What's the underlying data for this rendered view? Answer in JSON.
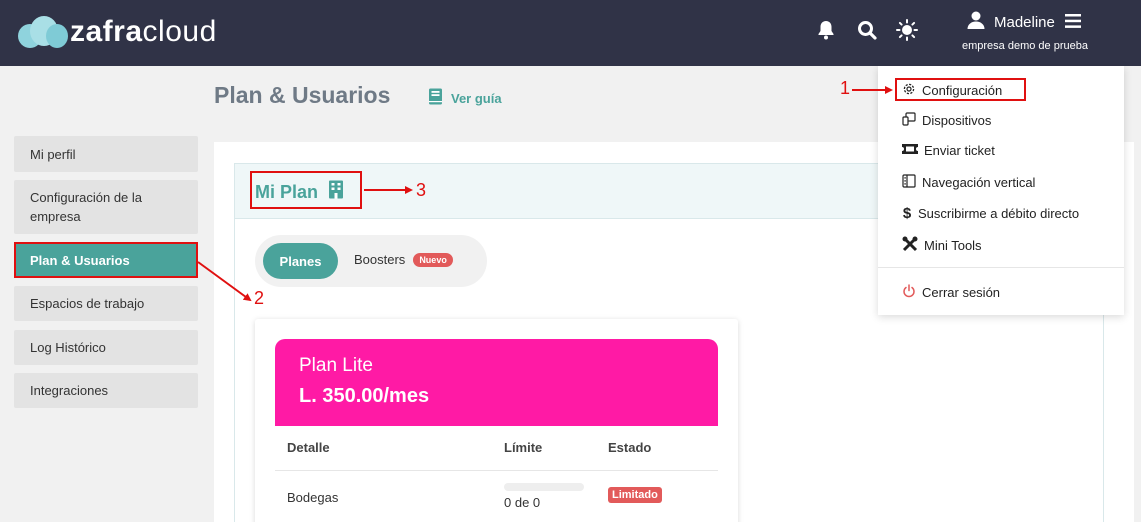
{
  "header": {
    "logo_bold": "zafra",
    "logo_light": "cloud",
    "icons": [
      "bell-icon",
      "search-icon",
      "sun-icon"
    ],
    "user_name": "Madeline",
    "company": "empresa demo de prueba"
  },
  "page": {
    "title": "Plan & Usuarios",
    "guide_link": "Ver guía"
  },
  "sidebar": {
    "items": [
      {
        "label": "Mi perfil"
      },
      {
        "label": "Configuración de la empresa"
      },
      {
        "label": "Plan & Usuarios",
        "active": true
      },
      {
        "label": "Espacios de trabajo"
      },
      {
        "label": "Log Histórico"
      },
      {
        "label": "Integraciones"
      }
    ]
  },
  "plan_section": {
    "title": "Mi Plan",
    "tabs": [
      {
        "label": "Planes",
        "active": true
      },
      {
        "label": "Boosters",
        "badge": "Nuevo"
      }
    ],
    "card": {
      "name": "Plan Lite",
      "price": "L. 350.00/mes",
      "color": "#ff1aa5",
      "columns": [
        "Detalle",
        "Límite",
        "Estado"
      ],
      "rows": [
        {
          "detalle": "Bodegas",
          "limite": "0 de 0",
          "progress": 0,
          "estado": "Limitado"
        }
      ]
    }
  },
  "dropdown": {
    "items": [
      {
        "label": "Configuración",
        "icon": "gear-icon"
      },
      {
        "label": "Dispositivos",
        "icon": "devices-icon"
      },
      {
        "label": "Enviar ticket",
        "icon": "ticket-icon"
      },
      {
        "label": "Navegación vertical",
        "icon": "sidebar-layout-icon"
      },
      {
        "label": "Suscribirme a débito directo",
        "icon": "dollar-icon"
      },
      {
        "label": "Mini Tools",
        "icon": "tools-icon"
      }
    ],
    "logout": {
      "label": "Cerrar sesión",
      "icon": "power-icon"
    }
  },
  "annotations": {
    "marker_1": "1",
    "marker_2": "2",
    "marker_3": "3",
    "color": "#e01010"
  },
  "colors": {
    "topbar": "#303347",
    "accent": "#4aa39b",
    "danger": "#e25a5a"
  }
}
